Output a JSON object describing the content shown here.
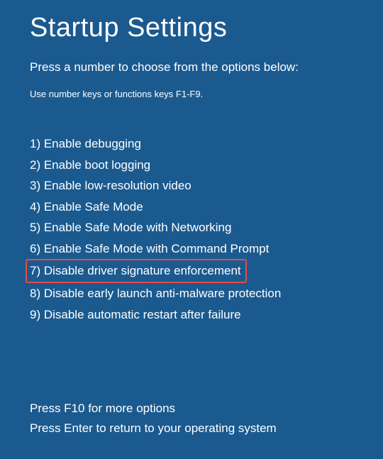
{
  "title": "Startup Settings",
  "subtitle": "Press a number to choose from the options below:",
  "instructions": "Use number keys or functions keys F1-F9.",
  "options": [
    {
      "number": "1",
      "label": "Enable debugging",
      "highlighted": false
    },
    {
      "number": "2",
      "label": "Enable boot logging",
      "highlighted": false
    },
    {
      "number": "3",
      "label": "Enable low-resolution video",
      "highlighted": false
    },
    {
      "number": "4",
      "label": "Enable Safe Mode",
      "highlighted": false
    },
    {
      "number": "5",
      "label": "Enable Safe Mode with Networking",
      "highlighted": false
    },
    {
      "number": "6",
      "label": "Enable Safe Mode with Command Prompt",
      "highlighted": false
    },
    {
      "number": "7",
      "label": "Disable driver signature enforcement",
      "highlighted": true
    },
    {
      "number": "8",
      "label": "Disable early launch anti-malware protection",
      "highlighted": false
    },
    {
      "number": "9",
      "label": "Disable automatic restart after failure",
      "highlighted": false
    }
  ],
  "footer": {
    "line1": "Press F10 for more options",
    "line2": "Press Enter to return to your operating system"
  }
}
